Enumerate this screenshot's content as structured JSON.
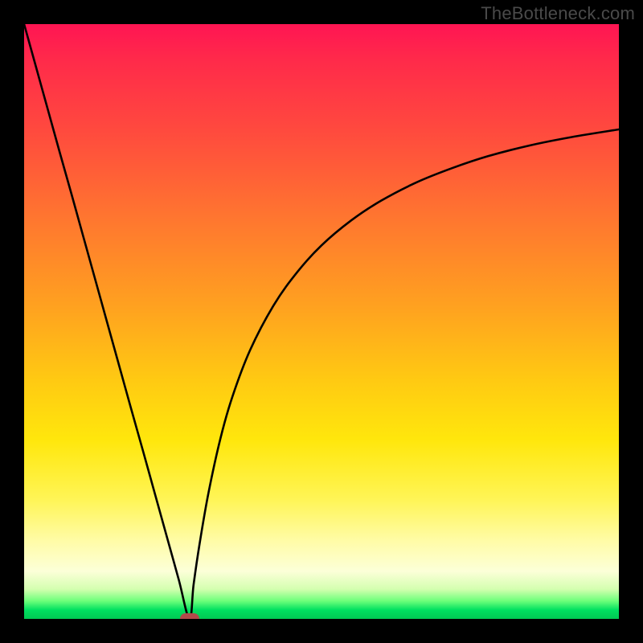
{
  "watermark": "TheBottleneck.com",
  "chart_data": {
    "type": "line",
    "title": "",
    "xlabel": "",
    "ylabel": "",
    "xlim": [
      0,
      100
    ],
    "ylim": [
      0,
      100
    ],
    "grid": false,
    "legend": false,
    "background": "red-yellow-green vertical gradient",
    "series": [
      {
        "name": "left-branch",
        "x": [
          0,
          2,
          4,
          6,
          8,
          10,
          12,
          14,
          16,
          18,
          20,
          22,
          24,
          26,
          27.8
        ],
        "y": [
          100,
          92.8,
          85.6,
          78.4,
          71.3,
          64.1,
          56.9,
          49.7,
          42.5,
          35.3,
          28.2,
          21.0,
          13.8,
          6.6,
          0
        ]
      },
      {
        "name": "right-branch",
        "x": [
          27.8,
          28.5,
          29.5,
          31,
          33,
          35,
          38,
          42,
          46,
          50,
          55,
          60,
          66,
          72,
          78,
          85,
          92,
          100
        ],
        "y": [
          0,
          5.8,
          12.6,
          21.2,
          30.3,
          37.3,
          45.2,
          52.8,
          58.4,
          62.8,
          67.0,
          70.3,
          73.4,
          75.8,
          77.8,
          79.6,
          81.0,
          82.3
        ]
      }
    ],
    "marker": {
      "x": 27.8,
      "y": 0,
      "shape": "rounded-rect",
      "color": "#b24a4a"
    }
  }
}
